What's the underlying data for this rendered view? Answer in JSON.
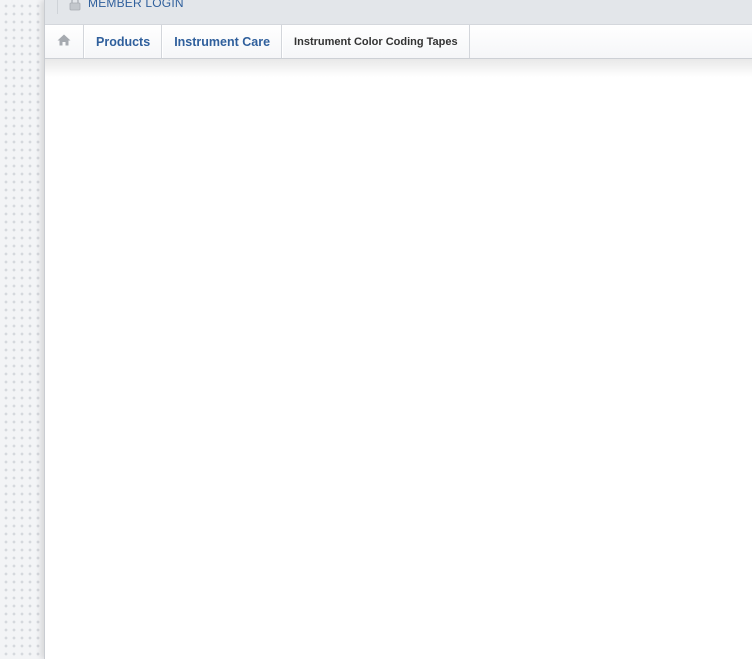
{
  "topbar": {
    "login_label": "MEMBER LOGIN",
    "lock_icon": "lock-icon"
  },
  "breadcrumb": {
    "home_icon": "home-icon",
    "items": [
      {
        "label": "Products"
      },
      {
        "label": "Instrument Care"
      }
    ],
    "current": "Instrument Color Coding Tapes"
  },
  "colors": {
    "link": "#2f5f9c",
    "current_text": "#333333",
    "topbar_bg": "#e3e6ea",
    "icon_gray": "#a6aab0"
  }
}
